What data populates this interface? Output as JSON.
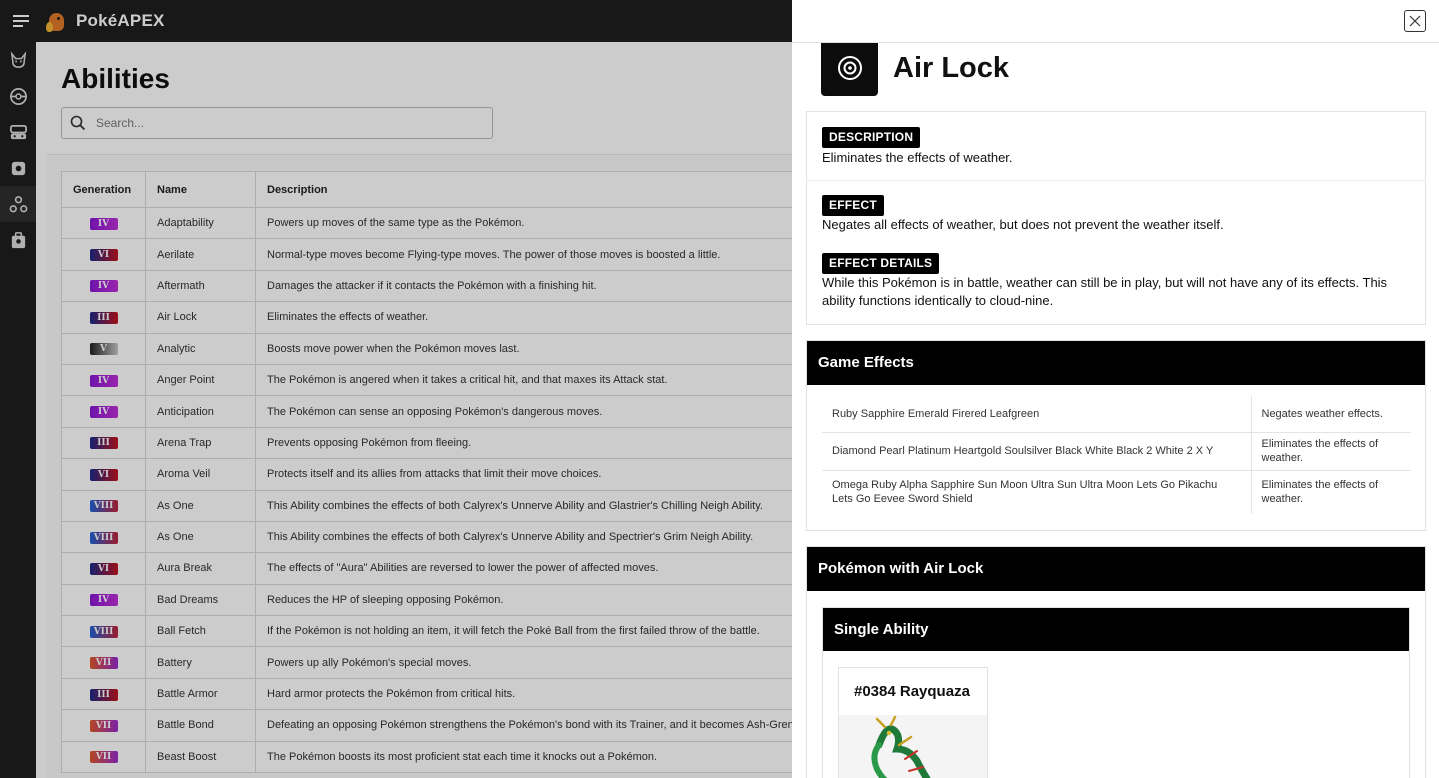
{
  "app": {
    "name": "PokéAPEX"
  },
  "sidebar": {
    "items": [
      {
        "icon": "pikachu-icon"
      },
      {
        "icon": "pokeball-icon"
      },
      {
        "icon": "machine-icon"
      },
      {
        "icon": "item-icon"
      },
      {
        "icon": "abilities-icon",
        "active": true
      },
      {
        "icon": "backpack-icon"
      }
    ]
  },
  "page": {
    "title": "Abilities",
    "search_placeholder": "Search...",
    "columns": [
      "Generation",
      "Name",
      "Description"
    ],
    "rows": [
      {
        "gen": "IV",
        "name": "Adaptability",
        "desc": "Powers up moves of the same type as the Pokémon."
      },
      {
        "gen": "VI",
        "name": "Aerilate",
        "desc": "Normal-type moves become Flying-type moves. The power of those moves is boosted a little."
      },
      {
        "gen": "IV",
        "name": "Aftermath",
        "desc": "Damages the attacker if it contacts the Pokémon with a finishing hit."
      },
      {
        "gen": "III",
        "name": "Air Lock",
        "desc": "Eliminates the effects of weather."
      },
      {
        "gen": "V",
        "name": "Analytic",
        "desc": "Boosts move power when the Pokémon moves last."
      },
      {
        "gen": "IV",
        "name": "Anger Point",
        "desc": "The Pokémon is angered when it takes a critical hit, and that maxes its Attack stat."
      },
      {
        "gen": "IV",
        "name": "Anticipation",
        "desc": "The Pokémon can sense an opposing Pokémon's dangerous moves."
      },
      {
        "gen": "III",
        "name": "Arena Trap",
        "desc": "Prevents opposing Pokémon from fleeing."
      },
      {
        "gen": "VI",
        "name": "Aroma Veil",
        "desc": "Protects itself and its allies from attacks that limit their move choices."
      },
      {
        "gen": "VIII",
        "name": "As One",
        "desc": "This Ability combines the effects of both Calyrex's Unnerve Ability and Glastrier's Chilling Neigh Ability."
      },
      {
        "gen": "VIII",
        "name": "As One",
        "desc": "This Ability combines the effects of both Calyrex's Unnerve Ability and Spectrier's Grim Neigh Ability."
      },
      {
        "gen": "VI",
        "name": "Aura Break",
        "desc": "The effects of \"Aura\" Abilities are reversed to lower the power of affected moves."
      },
      {
        "gen": "IV",
        "name": "Bad Dreams",
        "desc": "Reduces the HP of sleeping opposing Pokémon."
      },
      {
        "gen": "VIII",
        "name": "Ball Fetch",
        "desc": "If the Pokémon is not holding an item, it will fetch the Poké Ball from the first failed throw of the battle."
      },
      {
        "gen": "VII",
        "name": "Battery",
        "desc": "Powers up ally Pokémon's special moves."
      },
      {
        "gen": "III",
        "name": "Battle Armor",
        "desc": "Hard armor protects the Pokémon from critical hits."
      },
      {
        "gen": "VII",
        "name": "Battle Bond",
        "desc": "Defeating an opposing Pokémon strengthens the Pokémon's bond with its Trainer, and it becomes Ash-Greninja."
      },
      {
        "gen": "VII",
        "name": "Beast Boost",
        "desc": "The Pokémon boosts its most proficient stat each time it knocks out a Pokémon."
      }
    ]
  },
  "detail": {
    "title": "Air Lock",
    "description_label": "DESCRIPTION",
    "description": "Eliminates the effects of weather.",
    "effect_label": "EFFECT",
    "effect": "Negates all effects of weather, but does not prevent the weather itself.",
    "effect_details_label": "EFFECT DETAILS",
    "effect_details": "While this Pokémon is in battle, weather can still be in play, but will not have any of its effects. This ability functions identically to cloud-nine.",
    "game_effects_title": "Game Effects",
    "game_effects": [
      {
        "games": "Ruby Sapphire Emerald Firered Leafgreen",
        "effect": "Negates weather effects."
      },
      {
        "games": "Diamond Pearl Platinum Heartgold Soulsilver Black White Black 2 White 2 X Y",
        "effect": "Eliminates the effects of weather."
      },
      {
        "games": "Omega Ruby Alpha Sapphire Sun Moon Ultra Sun Ultra Moon Lets Go Pikachu Lets Go Eevee Sword Shield",
        "effect": "Eliminates the effects of weather."
      }
    ],
    "pokemon_title": "Pokémon with Air Lock",
    "single_ability_title": "Single Ability",
    "pokemon": [
      {
        "label": "#0384 Rayquaza"
      }
    ]
  },
  "colors": {
    "III": [
      "#1c2a8a",
      "#c4141e"
    ],
    "IV": [
      "#8a1ad6",
      "#c02ed8"
    ],
    "V": [
      "#222222",
      "#c8c8c8"
    ],
    "VI": [
      "#1c2a8a",
      "#c4141e"
    ],
    "VII": [
      "#e0582a",
      "#9a2ad0"
    ],
    "VIII": [
      "#1e62d8",
      "#c2223a"
    ]
  }
}
